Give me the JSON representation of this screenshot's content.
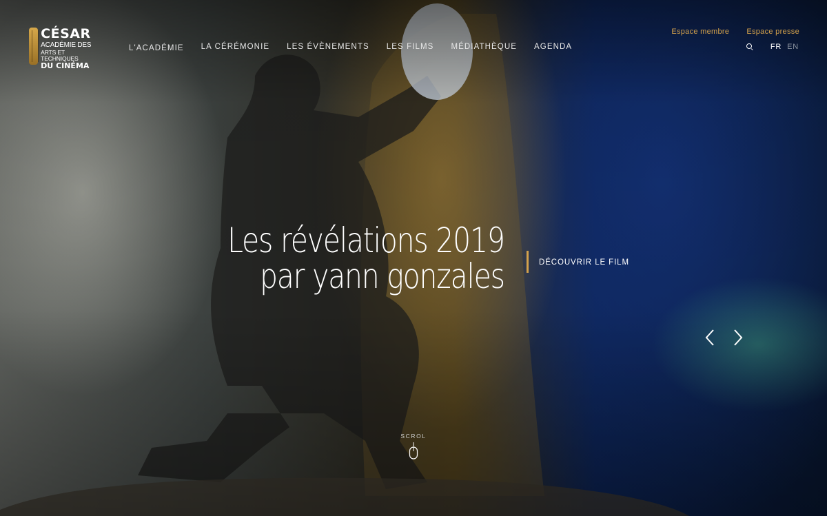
{
  "logo": {
    "line1": "CÉSAR",
    "line2": "ACADÉMIE DES",
    "line3": "ARTS ET TECHNIQUES",
    "line4": "DU CINÉMA"
  },
  "nav": {
    "items": [
      {
        "label": "L'ACADÉMIE"
      },
      {
        "label": "LA CÉRÉMONIE"
      },
      {
        "label": "LES ÉVÈNEMENTS"
      },
      {
        "label": "LES FILMS"
      },
      {
        "label": "MÉDIATHÈQUE"
      },
      {
        "label": "AGENDA"
      }
    ]
  },
  "top_links": {
    "member": "Espace membre",
    "press": "Espace presse"
  },
  "language": {
    "fr": "FR",
    "en": "EN",
    "active": "FR"
  },
  "hero": {
    "title_line1": "Les révélations 2019",
    "title_line2": "par yann gonzales",
    "cta": "DÉCOUVRIR LE FILM"
  },
  "scroll": {
    "label": "SCROL"
  },
  "colors": {
    "accent": "#d4a24c",
    "text": "#ffffff",
    "inactive": "#8c94a0"
  },
  "icons": [
    "search-icon",
    "chevron-left-icon",
    "chevron-right-icon",
    "mouse-icon"
  ]
}
